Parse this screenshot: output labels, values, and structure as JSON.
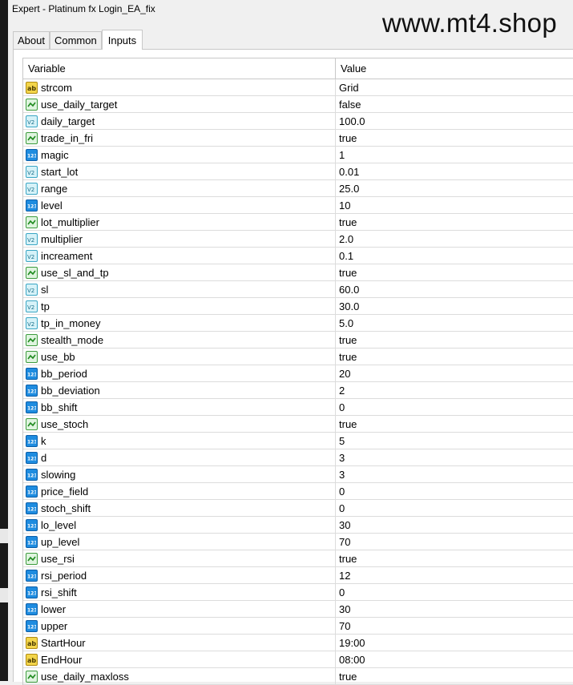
{
  "window": {
    "title": "Expert - Platinum fx Login_EA_fix"
  },
  "watermark": "www.mt4.shop",
  "tabs": [
    {
      "label": "About"
    },
    {
      "label": "Common"
    },
    {
      "label": "Inputs"
    }
  ],
  "grid": {
    "headers": {
      "variable": "Variable",
      "value": "Value"
    },
    "rows": [
      {
        "name": "strcom",
        "value": "Grid",
        "icon": "string-type-icon"
      },
      {
        "name": "use_daily_target",
        "value": "false",
        "icon": "bool-type-icon"
      },
      {
        "name": "daily_target",
        "value": "100.0",
        "icon": "double-type-icon"
      },
      {
        "name": "trade_in_fri",
        "value": "true",
        "icon": "bool-type-icon"
      },
      {
        "name": "magic",
        "value": "1",
        "icon": "int-type-icon"
      },
      {
        "name": "start_lot",
        "value": "0.01",
        "icon": "double-type-icon"
      },
      {
        "name": "range",
        "value": "25.0",
        "icon": "double-type-icon"
      },
      {
        "name": "level",
        "value": "10",
        "icon": "int-type-icon"
      },
      {
        "name": "lot_multiplier",
        "value": "true",
        "icon": "bool-type-icon"
      },
      {
        "name": "multiplier",
        "value": "2.0",
        "icon": "double-type-icon"
      },
      {
        "name": "increament",
        "value": "0.1",
        "icon": "double-type-icon"
      },
      {
        "name": "use_sl_and_tp",
        "value": "true",
        "icon": "bool-type-icon"
      },
      {
        "name": "sl",
        "value": "60.0",
        "icon": "double-type-icon"
      },
      {
        "name": "tp",
        "value": "30.0",
        "icon": "double-type-icon"
      },
      {
        "name": "tp_in_money",
        "value": "5.0",
        "icon": "double-type-icon"
      },
      {
        "name": "stealth_mode",
        "value": "true",
        "icon": "bool-type-icon"
      },
      {
        "name": "use_bb",
        "value": "true",
        "icon": "bool-type-icon"
      },
      {
        "name": "bb_period",
        "value": "20",
        "icon": "int-type-icon"
      },
      {
        "name": "bb_deviation",
        "value": "2",
        "icon": "int-type-icon"
      },
      {
        "name": "bb_shift",
        "value": "0",
        "icon": "int-type-icon"
      },
      {
        "name": "use_stoch",
        "value": "true",
        "icon": "bool-type-icon"
      },
      {
        "name": "k",
        "value": "5",
        "icon": "int-type-icon"
      },
      {
        "name": "d",
        "value": "3",
        "icon": "int-type-icon"
      },
      {
        "name": "slowing",
        "value": "3",
        "icon": "int-type-icon"
      },
      {
        "name": "price_field",
        "value": "0",
        "icon": "int-type-icon"
      },
      {
        "name": "stoch_shift",
        "value": "0",
        "icon": "int-type-icon"
      },
      {
        "name": "lo_level",
        "value": "30",
        "icon": "int-type-icon"
      },
      {
        "name": "up_level",
        "value": "70",
        "icon": "int-type-icon"
      },
      {
        "name": "use_rsi",
        "value": "true",
        "icon": "bool-type-icon"
      },
      {
        "name": "rsi_period",
        "value": "12",
        "icon": "int-type-icon"
      },
      {
        "name": "rsi_shift",
        "value": "0",
        "icon": "int-type-icon"
      },
      {
        "name": "lower",
        "value": "30",
        "icon": "int-type-icon"
      },
      {
        "name": "upper",
        "value": "70",
        "icon": "int-type-icon"
      },
      {
        "name": "StartHour",
        "value": "19:00",
        "icon": "string-type-icon"
      },
      {
        "name": "EndHour",
        "value": "08:00",
        "icon": "string-type-icon"
      },
      {
        "name": "use_daily_maxloss",
        "value": "true",
        "icon": "bool-type-icon"
      }
    ]
  }
}
